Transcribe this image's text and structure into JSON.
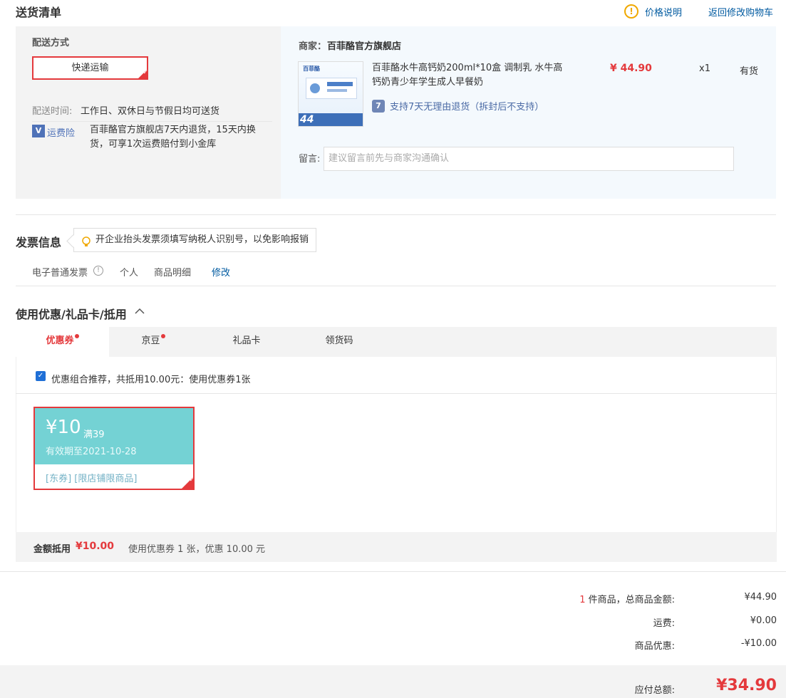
{
  "header": {
    "title": "送货清单",
    "price_info": "价格说明",
    "back_to_cart": "返回修改购物车"
  },
  "delivery": {
    "method_label": "配送方式",
    "method_value": "快递运输",
    "time_label": "配送时间:",
    "time_value": "工作日、双休日与节假日均可送货",
    "insurance_label": "运费险",
    "insurance_text": "百菲酪官方旗舰店7天内退货，15天内换货，可享1次运费赔付到小金库"
  },
  "shop": {
    "label": "商家：",
    "name": "百菲酪官方旗舰店"
  },
  "product": {
    "title": "百菲酪水牛高钙奶200ml*10盒 调制乳 水牛高钙奶青少年学生成人早餐奶",
    "price": "¥ 44.90",
    "qty": "x1",
    "stock": "有货",
    "return_policy": "支持7天无理由退货（拆封后不支持）",
    "img_brand": "百菲酪",
    "img_badge": "44"
  },
  "message": {
    "label": "留言:",
    "placeholder": "建议留言前先与商家沟通确认"
  },
  "invoice": {
    "title": "发票信息",
    "tip": "开企业抬头发票须填写纳税人识别号，以免影响报销",
    "type": "电子普通发票",
    "holder": "个人",
    "content": "商品明细",
    "edit": "修改"
  },
  "discount": {
    "title": "使用优惠/礼品卡/抵用",
    "tabs": [
      {
        "label": "优惠券"
      },
      {
        "label": "京豆"
      },
      {
        "label": "礼品卡"
      },
      {
        "label": "领货码"
      }
    ],
    "recommend_text": "优惠组合推荐，共抵用10.00元：使用优惠券1张",
    "coupon": {
      "amount": "¥10",
      "condition": "满39",
      "validity": "有效期至2021-10-28",
      "tags": "[东券]  [限店铺限商品]"
    },
    "deduct_label": "金额抵用",
    "deduct_amount": "¥10.00",
    "deduct_detail": "使用优惠券 1 张，优惠 10.00 元"
  },
  "summary": {
    "count": "1",
    "count_text": "件商品，总商品金额:",
    "goods_total": "¥44.90",
    "shipping_label": "运费:",
    "shipping_value": "¥0.00",
    "discount_label": "商品优惠:",
    "discount_value": "-¥10.00",
    "payable_label": "应付总额:",
    "payable_value": "¥34.90"
  },
  "colors": {
    "accent": "#e4393c",
    "link": "#005aa0",
    "coupon": "#74d2d4"
  }
}
